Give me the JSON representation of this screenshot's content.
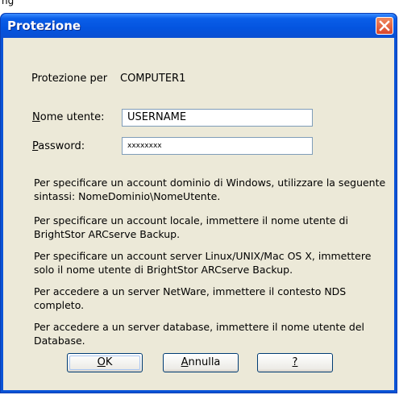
{
  "crumb": "ng",
  "window": {
    "title": "Protezione"
  },
  "protection_for": {
    "label": "Protezione per",
    "value": "COMPUTER1"
  },
  "username": {
    "label_mnemonic": "N",
    "label_rest": "ome utente:",
    "value": "USERNAME"
  },
  "password": {
    "label_mnemonic": "P",
    "label_rest": "assword:",
    "value": "xxxxxxxx"
  },
  "info": [
    "Per specificare un account dominio di Windows, utilizzare la seguente sintassi: NomeDominio\\NomeUtente.",
    "Per specificare un account locale, immettere il nome utente di BrightStor ARCserve Backup.",
    "Per specificare un account server Linux/UNIX/Mac OS X, immettere solo il nome utente di BrightStor ARCserve Backup.",
    "Per accedere a un server NetWare, immettere il contesto NDS completo.",
    "Per accedere a un server database, immettere il nome utente del Database."
  ],
  "buttons": {
    "ok": {
      "mnemonic": "O",
      "rest": "K"
    },
    "cancel": {
      "mnemonic": "A",
      "rest": "nnulla"
    },
    "help": {
      "mnemonic": "?",
      "rest": ""
    }
  }
}
